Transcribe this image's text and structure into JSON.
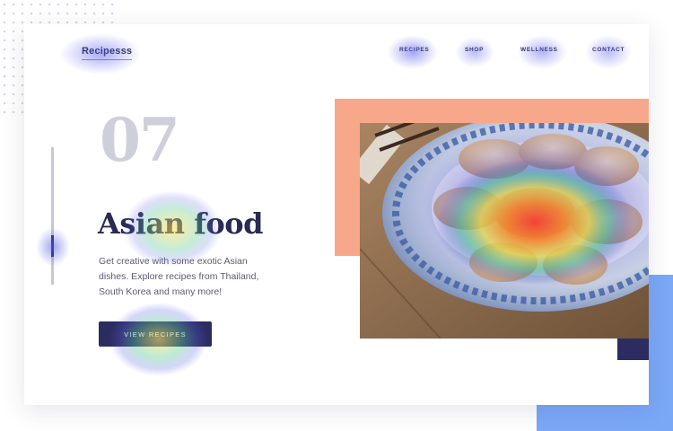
{
  "brand": {
    "logo_text": "Recipesss"
  },
  "nav": {
    "items": [
      {
        "label": "RECIPES"
      },
      {
        "label": "SHOP"
      },
      {
        "label": "WELLNESS"
      },
      {
        "label": "CONTACT"
      }
    ]
  },
  "hero": {
    "number": "07",
    "title": "Asian food",
    "description": "Get creative with some exotic Asian dishes. Explore recipes from Thailand, South Korea and many more!",
    "cta_label": "VIEW RECIPES"
  },
  "image": {
    "subject": "plate of asian dumplings with heatmap overlay"
  },
  "colors": {
    "navy": "#2d2c61",
    "salmon": "#f7a88a",
    "accent_blue": "#7aa8f7",
    "number_gray": "#cfcfdc"
  }
}
